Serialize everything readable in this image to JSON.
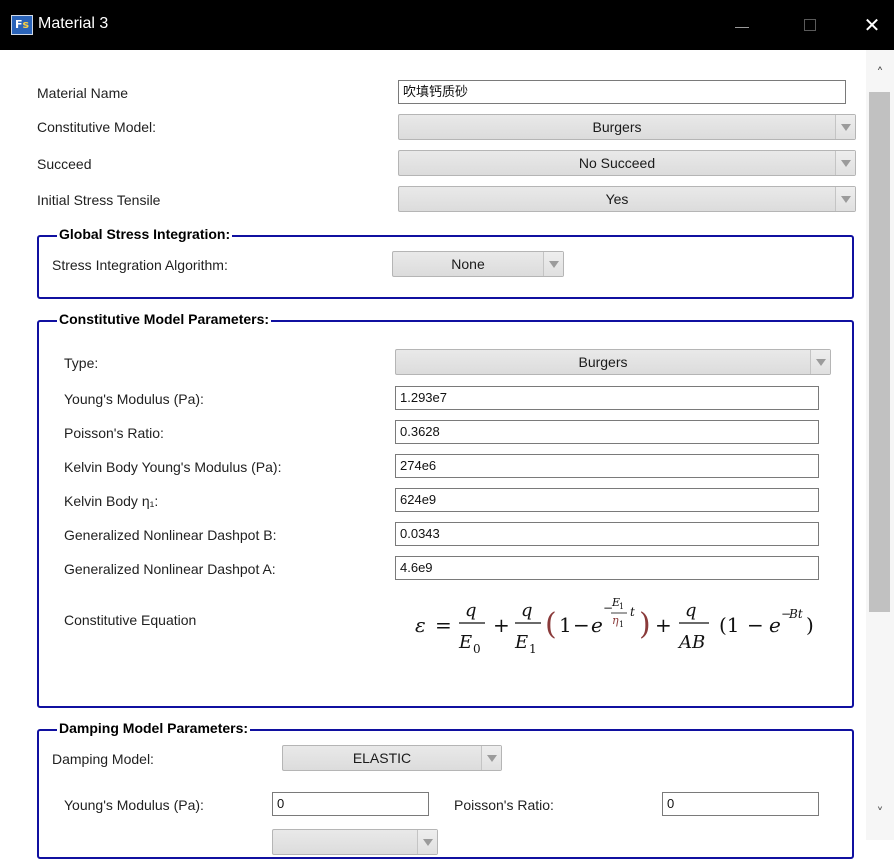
{
  "window": {
    "app_icon": "fsi-app-icon",
    "title": "Material 3",
    "controls": [
      "minimize-icon",
      "maximize-icon",
      "close-icon"
    ]
  },
  "material": {
    "name_label": "Material Name",
    "name_value": "吹填钙质砂",
    "constitutive_label": "Constitutive Model:",
    "constitutive_value": "Burgers",
    "succeed_label": "Succeed",
    "succeed_value": "No Succeed",
    "initial_stress_label": "Initial Stress Tensile",
    "initial_stress_value": "Yes"
  },
  "global_stress": {
    "title": "Global Stress Integration:",
    "algorithm_label": "Stress Integration Algorithm:",
    "algorithm_value": "None"
  },
  "constitutive_params": {
    "title": "Constitutive Model Parameters:",
    "type_label": "Type:",
    "type_value": "Burgers",
    "fields": [
      {
        "label": "Young's Modulus (Pa):",
        "value": "1.293e7"
      },
      {
        "label": "Poisson's Ratio:",
        "value": "0.3628"
      },
      {
        "label": "Kelvin Body Young's Modulus (Pa):",
        "value": "274e6"
      },
      {
        "label": "Kelvin Body η₁:",
        "value": "624e9"
      },
      {
        "label": "Generalized Nonlinear Dashpot B:",
        "value": "0.0343"
      },
      {
        "label": "Generalized Nonlinear Dashpot A:",
        "value": "4.6e9"
      }
    ],
    "equation_label": "Constitutive Equation"
  },
  "damping": {
    "title": "Damping Model Parameters:",
    "model_label": "Damping Model:",
    "model_value": "ELASTIC",
    "youngs_label": "Young's Modulus (Pa):",
    "youngs_value": "0",
    "poisson_label": "Poisson's Ratio:",
    "poisson_value": "0"
  },
  "scrollbar": {
    "up_icon": "chevron-up-icon",
    "down_icon": "chevron-down-icon"
  },
  "colors": {
    "group_border": "#1010a0",
    "titlebar": "#000000",
    "accent_eta": "#8a3a3a"
  }
}
